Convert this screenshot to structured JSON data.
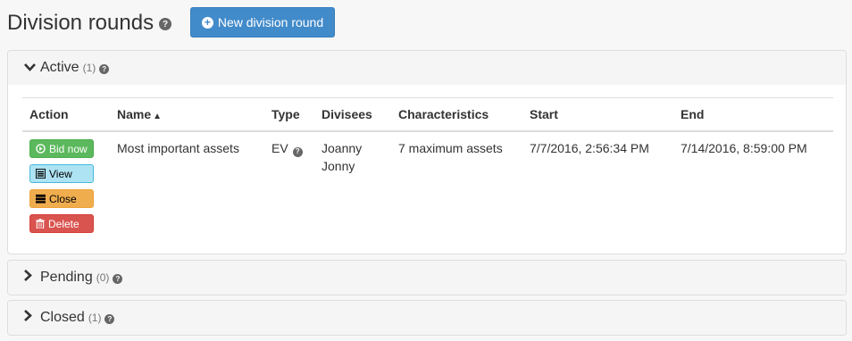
{
  "header": {
    "title": "Division rounds",
    "new_button_label": "New division round"
  },
  "sections": {
    "active": {
      "label": "Active",
      "count": "(1)",
      "chevron": "chevron-down-icon"
    },
    "pending": {
      "label": "Pending",
      "count": "(0)",
      "chevron": "chevron-right-icon"
    },
    "closed": {
      "label": "Closed",
      "count": "(1)",
      "chevron": "chevron-right-icon"
    }
  },
  "table": {
    "columns": {
      "action": "Action",
      "name": "Name",
      "type": "Type",
      "divisees": "Divisees",
      "characteristics": "Characteristics",
      "start": "Start",
      "end": "End"
    },
    "sort": {
      "column": "Name",
      "direction": "ascending",
      "icon": "caret-up-icon"
    },
    "rows": [
      {
        "actions": {
          "bid": "Bid now",
          "view": "View",
          "close": "Close",
          "delete": "Delete"
        },
        "name": "Most important assets",
        "type": "EV",
        "divisees": [
          "Joanny",
          "Jonny"
        ],
        "characteristics": "7 maximum assets",
        "start": "7/7/2016, 2:56:34 PM",
        "end": "7/14/2016, 8:59:00 PM"
      }
    ]
  },
  "colors": {
    "primary": "#428bca",
    "success": "#5cb85c",
    "info": "#aee3f3",
    "warning": "#f0ad4e",
    "danger": "#d9534f"
  }
}
